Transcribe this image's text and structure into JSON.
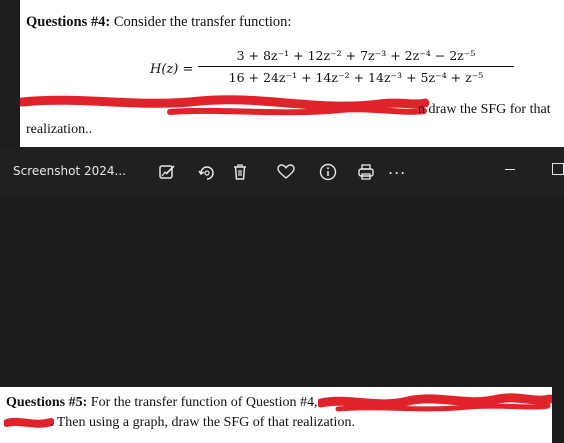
{
  "document_top": {
    "question_label": "Questions #4:",
    "question_text": "Consider the transfer function:",
    "equation_lhs": "H(z) =",
    "numerator": "3 + 8z⁻¹ + 12z⁻² + 7z⁻³ + 2z⁻⁴ − 2z⁻⁵",
    "denominator": "16 + 24z⁻¹ + 14z⁻² + 14z⁻³ + 5z⁻⁴ + z⁻⁵",
    "line3_visible": "n draw the SFG for that",
    "line4_visible": "realization.."
  },
  "viewer_toolbar": {
    "file_title": "Screenshot 2024...",
    "icons": [
      "edit-image-icon",
      "rotate-icon",
      "delete-icon",
      "favorite-icon",
      "info-icon",
      "print-icon"
    ],
    "more_label": "..."
  },
  "document_bottom": {
    "question_label": "Questions #5:",
    "line1_text": "For the transfer function of Question #4,",
    "line2_text": ". Then using a graph, draw the SFG of that realization."
  },
  "colors": {
    "redaction": "#e0232a",
    "toolbar_bg": "#202020",
    "viewer_bg": "#1c1c1c"
  }
}
